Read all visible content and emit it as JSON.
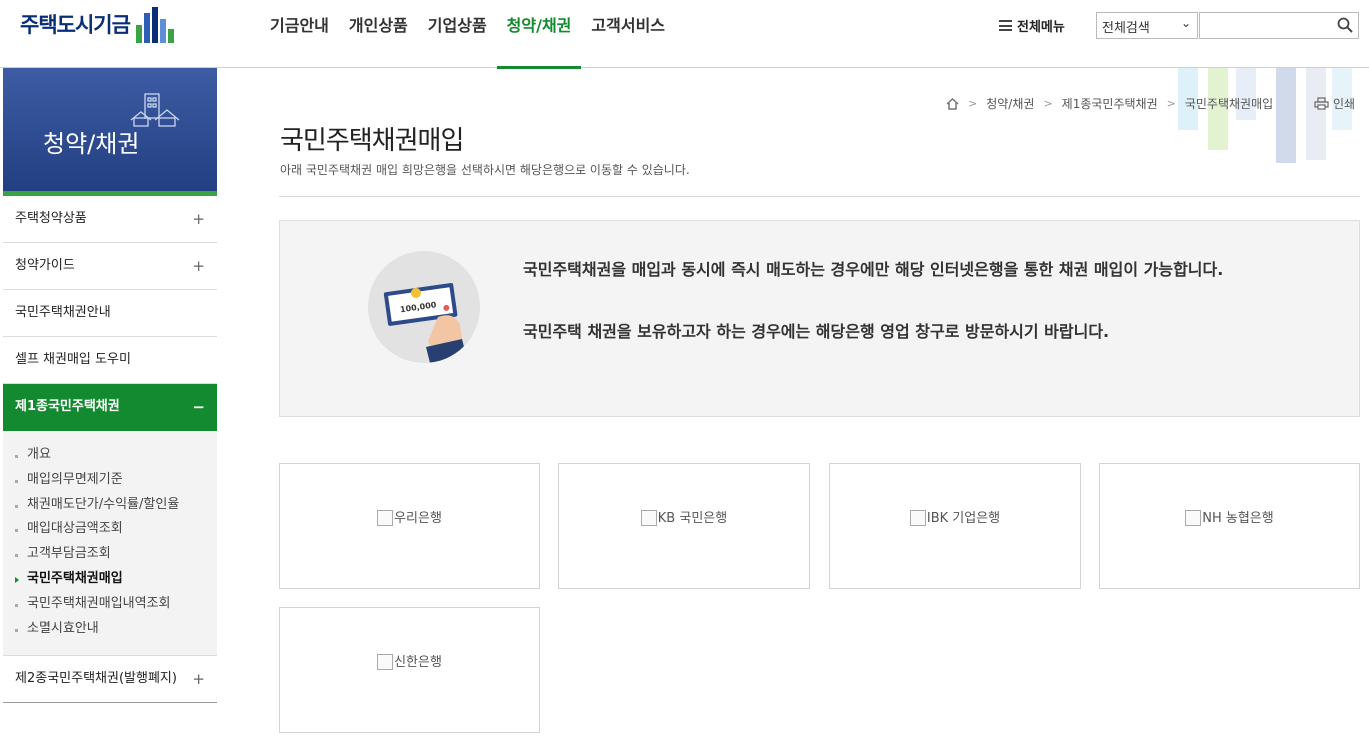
{
  "header": {
    "logo_text": "주택도시기금",
    "nav": [
      "기금안내",
      "개인상품",
      "기업상품",
      "청약/채권",
      "고객서비스"
    ],
    "nav_active_index": 3,
    "all_menu_label": "전체메뉴",
    "search_select_value": "전체검색",
    "search_placeholder": ""
  },
  "sidebar": {
    "title": "청약/채권",
    "items_before": [
      {
        "label": "주택청약상품",
        "toggle": "+"
      },
      {
        "label": "청약가이드",
        "toggle": "+"
      },
      {
        "label": "국민주택채권안내",
        "toggle": ""
      },
      {
        "label": "셀프 채권매입 도우미",
        "toggle": ""
      }
    ],
    "open_item": {
      "label": "제1종국민주택채권",
      "toggle": "−"
    },
    "sub_items": [
      "개요",
      "매입의무면제기준",
      "채권매도단가/수익률/할인율",
      "매입대상금액조회",
      "고객부담금조회",
      "국민주택채권매입",
      "국민주택채권매입내역조회",
      "소멸시효안내"
    ],
    "sub_current_index": 5,
    "items_after": [
      {
        "label": "제2종국민주택채권(발행폐지)",
        "toggle": "+"
      }
    ]
  },
  "breadcrumb": [
    "청약/채권",
    "제1종국민주택채권",
    "국민주택채권매입"
  ],
  "print_label": "인쇄",
  "page": {
    "title": "국민주택채권매입",
    "description": "아래 국민주택채권 매입 희망은행을 선택하시면 해당은행으로 이동할 수 있습니다."
  },
  "info": {
    "amount": "100,000",
    "line1": "국민주택채권을 매입과 동시에 즉시 매도하는 경우에만 해당 인터넷은행을 통한 채권 매입이 가능합니다.",
    "line2": "국민주택 채권을 보유하고자 하는 경우에는 해당은행 영업 창구로 방문하시기 바랍니다."
  },
  "banks": [
    "우리은행",
    "KB 국민은행",
    "IBK 기업은행",
    "NH 농협은행",
    "신한은행"
  ],
  "colors": {
    "primary_green": "#138a2f",
    "navy": "#233f83",
    "logo_navy": "#0a2d78"
  }
}
